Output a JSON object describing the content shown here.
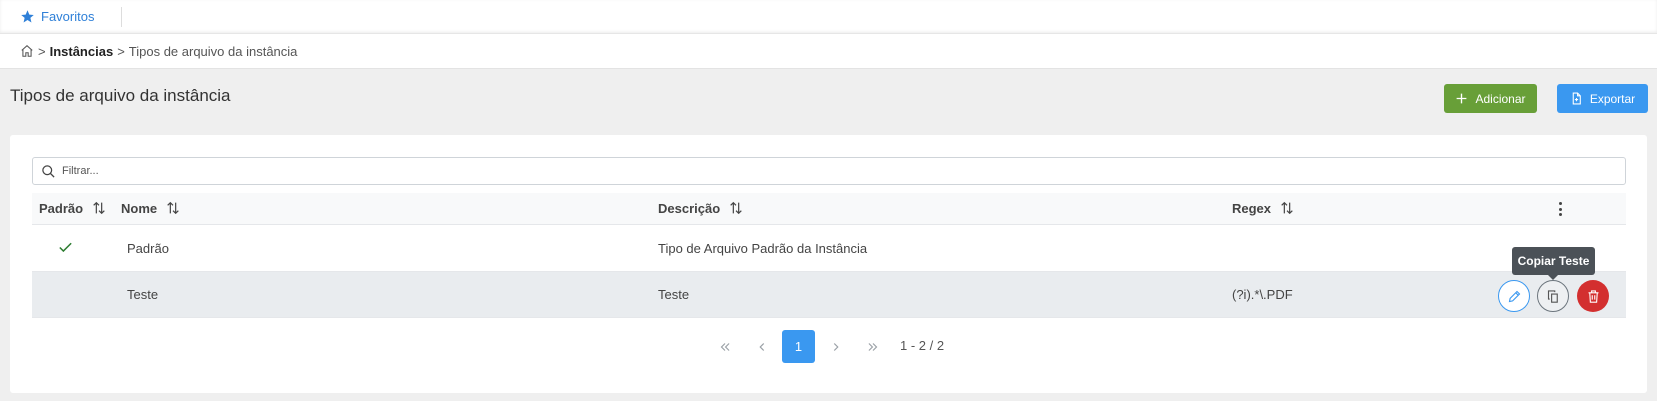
{
  "topbar": {
    "favorites_label": "Favoritos"
  },
  "breadcrumb": {
    "sep1": ">",
    "instances": "Instâncias",
    "sep2": ">",
    "current": "Tipos de arquivo da instância"
  },
  "page": {
    "title": "Tipos de arquivo da instância"
  },
  "toolbar": {
    "add_label": "Adicionar",
    "export_label": "Exportar"
  },
  "filter": {
    "placeholder": "Filtrar...",
    "value": ""
  },
  "table": {
    "headers": {
      "padrao": "Padrão",
      "nome": "Nome",
      "descricao": "Descrição",
      "regex": "Regex"
    },
    "rows": [
      {
        "padrao": true,
        "nome": "Padrão",
        "descricao": "Tipo de Arquivo Padrão da Instância",
        "regex": ""
      },
      {
        "padrao": false,
        "nome": "Teste",
        "descricao": "Teste",
        "regex": "(?i).*\\.PDF"
      }
    ]
  },
  "tooltip": {
    "text": "Copiar Teste"
  },
  "pagination": {
    "current_page": "1",
    "range": "1 - 2 / 2"
  },
  "colors": {
    "accent": "#3a98f0",
    "success": "#689f38",
    "danger": "#d32f2f",
    "check": "#2e7d32"
  }
}
